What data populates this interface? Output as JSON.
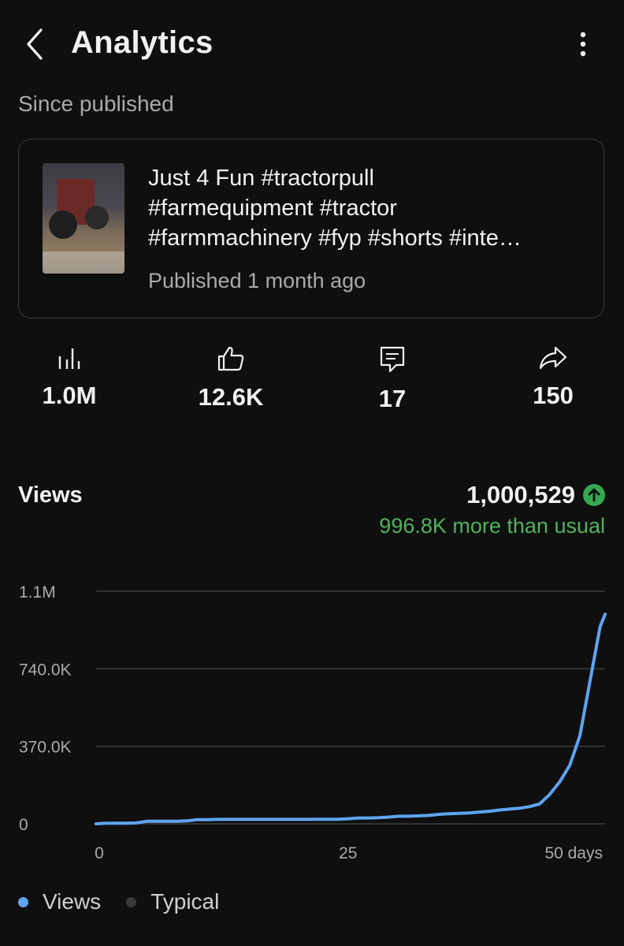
{
  "header": {
    "title": "Analytics"
  },
  "since_label": "Since published",
  "video": {
    "title_lines": [
      "Just 4 Fun #tractorpull",
      "#farmequipment #tractor",
      "#farmmachinery #fyp #shorts #inte…"
    ],
    "published": "Published 1 month ago"
  },
  "stats": {
    "views": "1.0M",
    "likes": "12.6K",
    "comments": "17",
    "shares": "150"
  },
  "views_section": {
    "label": "Views",
    "total": "1,000,529",
    "comparison": "996.8K more than usual"
  },
  "legend": {
    "views": "Views",
    "typical": "Typical"
  },
  "colors": {
    "accent_line": "#5ea4f2",
    "positive": "#4fb15e",
    "typical_dot": "#3a3a3a"
  },
  "chart_data": {
    "type": "line",
    "y_tick_labels": [
      "0",
      "370.0K",
      "740.0K",
      "1.1M"
    ],
    "y_ticks": [
      0,
      370000,
      740000,
      1110000
    ],
    "x_tick_labels": [
      "0",
      "25",
      "50 days"
    ],
    "x_ticks": [
      0,
      25,
      50
    ],
    "xlim": [
      0,
      50.5
    ],
    "ylim": [
      0,
      1110000
    ],
    "series": [
      {
        "name": "Views",
        "x": [
          0,
          1,
          2,
          3,
          4,
          5,
          6,
          7,
          8,
          9,
          10,
          11,
          12,
          13,
          14,
          15,
          16,
          17,
          18,
          19,
          20,
          21,
          22,
          23,
          24,
          25,
          26,
          27,
          28,
          29,
          30,
          31,
          32,
          33,
          34,
          35,
          36,
          37,
          38,
          39,
          40,
          41,
          42,
          43,
          44,
          45,
          46,
          47,
          48,
          49,
          50,
          50.5
        ],
        "values": [
          0,
          3000,
          3000,
          3000,
          4000,
          12000,
          12000,
          12000,
          12000,
          14000,
          20000,
          20000,
          21000,
          21000,
          21000,
          21000,
          21000,
          21000,
          21000,
          21000,
          21000,
          21000,
          22000,
          22000,
          22000,
          24000,
          28000,
          28000,
          29000,
          32000,
          36000,
          36000,
          38000,
          40000,
          45000,
          48000,
          50000,
          52000,
          56000,
          60000,
          66000,
          70000,
          74000,
          82000,
          95000,
          140000,
          200000,
          280000,
          420000,
          680000,
          940000,
          1000529
        ]
      }
    ]
  }
}
